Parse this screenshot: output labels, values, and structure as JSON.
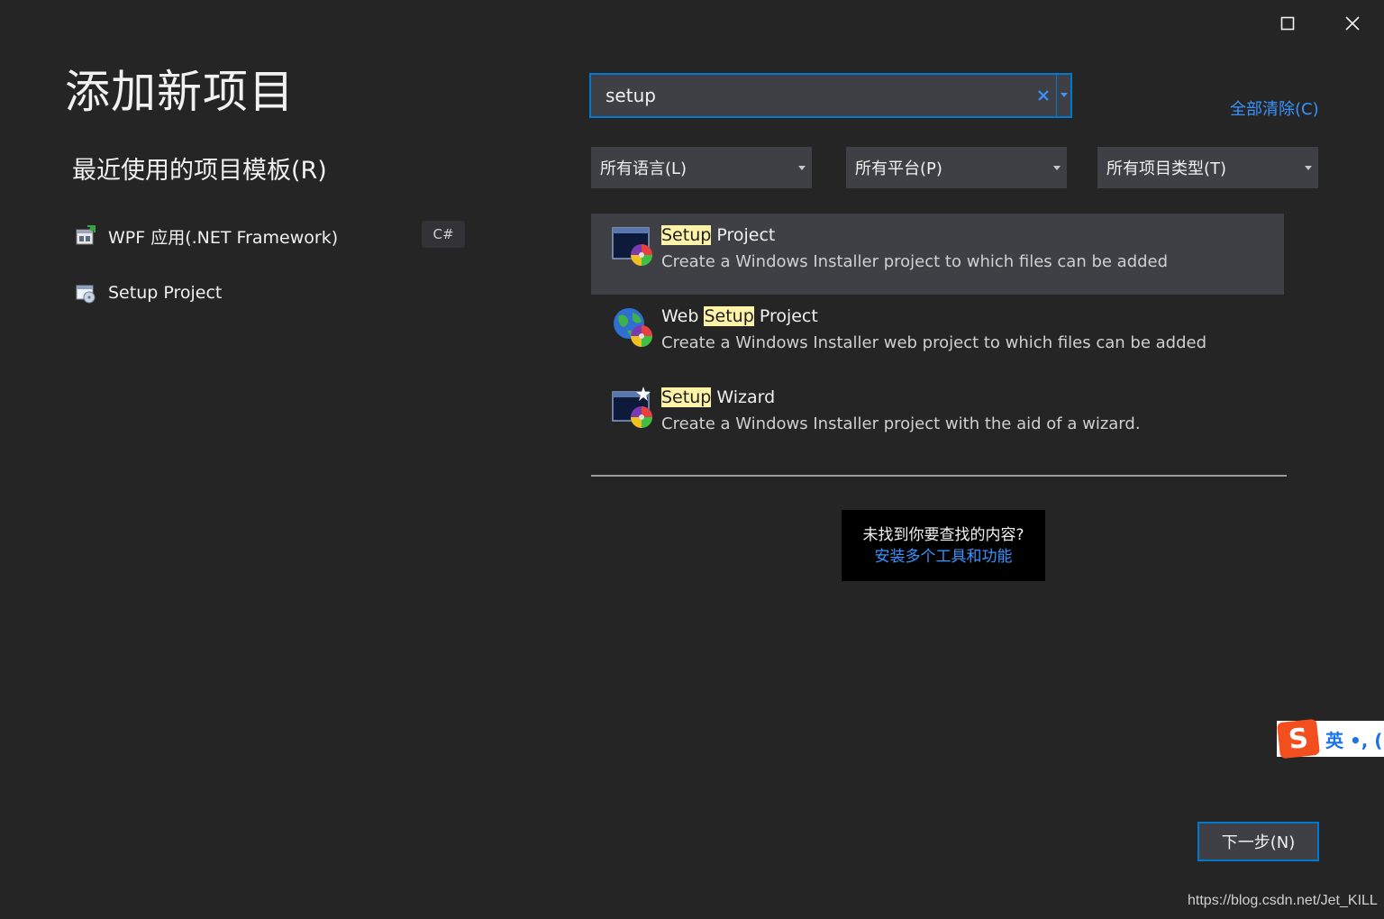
{
  "window": {
    "title": "添加新项目",
    "maximize_icon": "maximize-icon",
    "close_icon": "close-icon"
  },
  "recent": {
    "header": "最近使用的项目模板(R)",
    "items": [
      {
        "label": "WPF 应用(.NET Framework)",
        "badge": "C#",
        "icon": "wpf-app-icon"
      },
      {
        "label": "Setup Project",
        "icon": "setup-project-icon"
      }
    ]
  },
  "search": {
    "value": "setup",
    "placeholder": ""
  },
  "clear_all_label": "全部清除(C)",
  "filters": {
    "language": "所有语言(L)",
    "platform": "所有平台(P)",
    "project_type": "所有项目类型(T)"
  },
  "results": [
    {
      "name_pre": "",
      "name_hl": "Setup",
      "name_post": " Project",
      "description": "Create a Windows Installer project to which files can be added",
      "selected": true
    },
    {
      "name_pre": "Web ",
      "name_hl": "Setup",
      "name_post": " Project",
      "description": "Create a Windows Installer web project to which files can be added",
      "selected": false
    },
    {
      "name_pre": "",
      "name_hl": "Setup",
      "name_post": " Wizard",
      "description": "Create a Windows Installer project with the aid of a wizard.",
      "selected": false
    }
  ],
  "not_found": {
    "text": "未找到你要查找的内容?",
    "link": "安装多个工具和功能"
  },
  "ime": {
    "logo": "S",
    "text": "英 •, ("
  },
  "next_button": "下一步(N)",
  "watermark": "https://blog.csdn.net/Jet_KILL",
  "colors": {
    "background": "#252526",
    "accent": "#007acc",
    "link": "#3794ff",
    "highlight": "#fff3a8",
    "panel": "#3f3f46"
  }
}
